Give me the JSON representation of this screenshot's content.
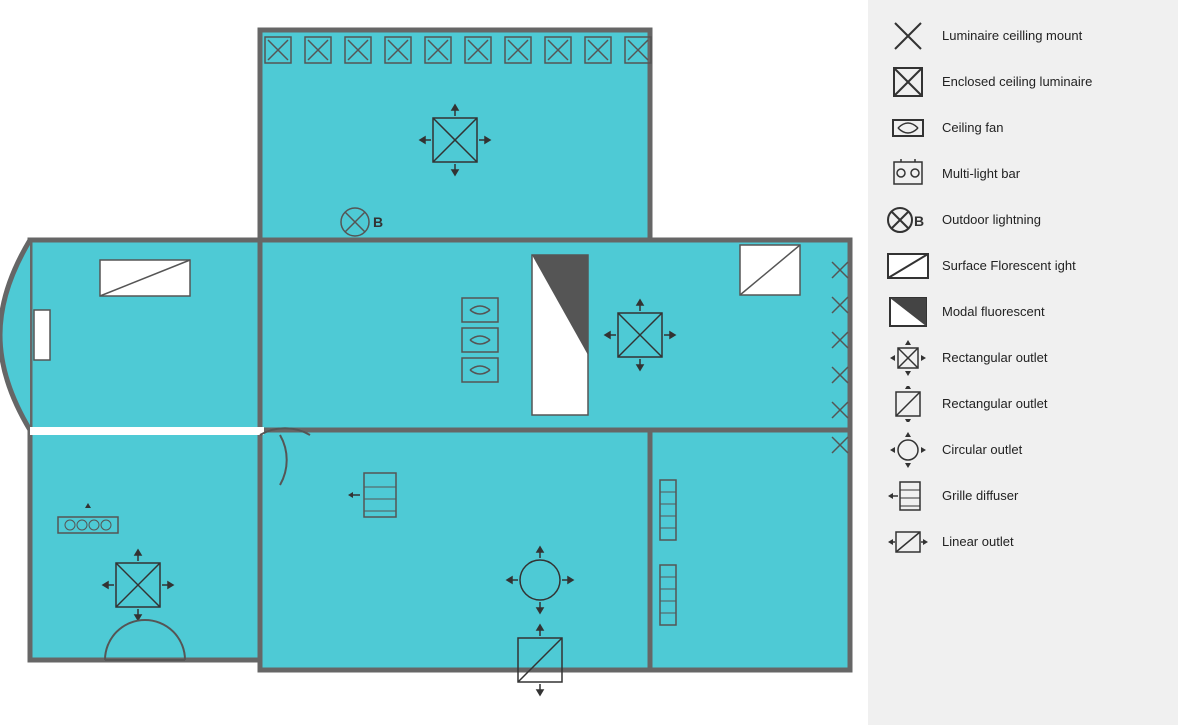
{
  "legend": {
    "items": [
      {
        "id": "luminaire-ceiling-mount",
        "label": "Luminaire ceilling mount",
        "icon": "x-square"
      },
      {
        "id": "enclosed-ceiling-luminaire",
        "label": "Enclosed ceiling luminaire",
        "icon": "x-square-inner"
      },
      {
        "id": "ceiling-fan",
        "label": "Ceiling fan",
        "icon": "infinity-box"
      },
      {
        "id": "multi-light-bar",
        "label": "Multi-light bar",
        "icon": "multi-bar"
      },
      {
        "id": "outdoor-lightning",
        "label": "Outdoor lightning",
        "icon": "x-circle-b"
      },
      {
        "id": "surface-florescent",
        "label": "Surface Florescent ight",
        "icon": "diagonal-rect"
      },
      {
        "id": "modal-fluorescent",
        "label": "Modal fluorescent",
        "icon": "triangle-rect"
      },
      {
        "id": "rectangular-outlet-arrows",
        "label": "Rectangular outlet",
        "icon": "rect-outlet-arrows"
      },
      {
        "id": "rectangular-outlet",
        "label": "Rectangular outlet",
        "icon": "rect-outlet-plain"
      },
      {
        "id": "circular-outlet",
        "label": "Circular outlet",
        "icon": "circle-outlet"
      },
      {
        "id": "grille-diffuser",
        "label": "Grille diffuser",
        "icon": "grille"
      },
      {
        "id": "linear-outlet",
        "label": "Linear outlet",
        "icon": "linear"
      }
    ]
  }
}
